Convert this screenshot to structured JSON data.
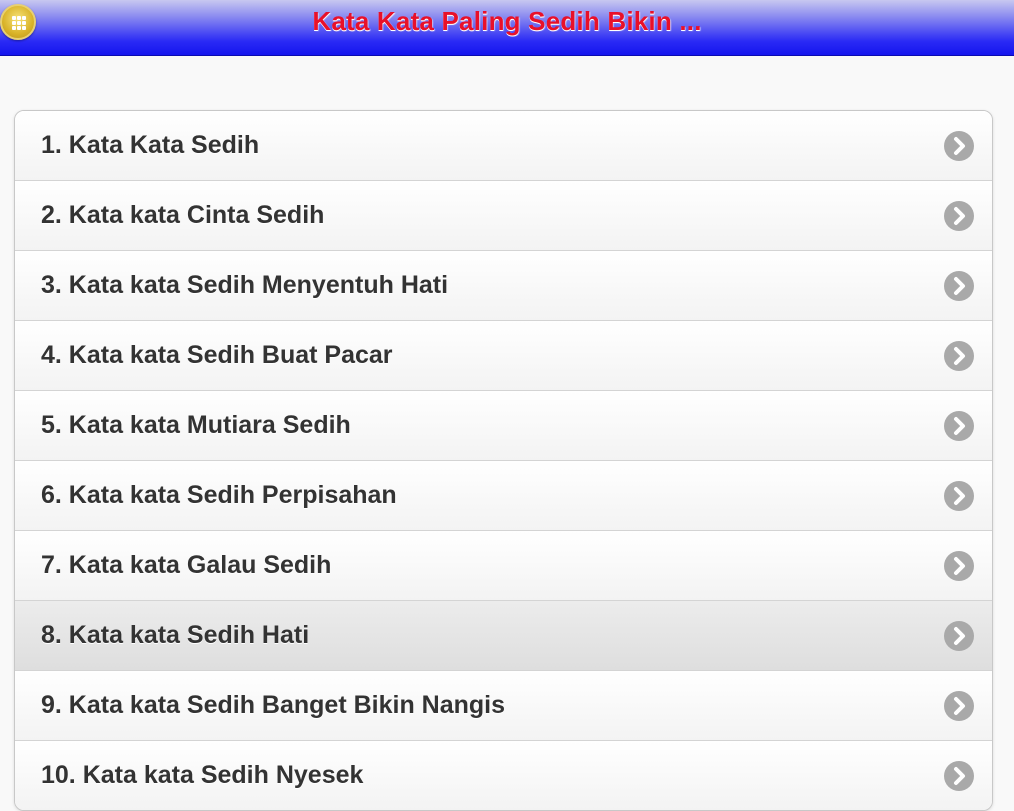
{
  "header": {
    "title": "Kata Kata Paling Sedih Bikin ...",
    "menu_icon": "grid-menu-icon"
  },
  "list": {
    "items": [
      {
        "label": "1. Kata Kata Sedih"
      },
      {
        "label": "2. Kata kata Cinta Sedih"
      },
      {
        "label": "3. Kata kata Sedih Menyentuh Hati"
      },
      {
        "label": "4. Kata kata Sedih Buat Pacar"
      },
      {
        "label": "5. Kata kata Mutiara Sedih"
      },
      {
        "label": "6. Kata kata Sedih Perpisahan"
      },
      {
        "label": "7. Kata kata Galau Sedih"
      },
      {
        "label": "8. Kata kata Sedih Hati"
      },
      {
        "label": "9. Kata kata Sedih Banget Bikin Nangis"
      },
      {
        "label": "10. Kata kata Sedih Nyesek"
      }
    ],
    "active_index": 7,
    "arrow_icon": "chevron-right-circle-icon"
  },
  "colors": {
    "title_red": "#e8102a",
    "header_blue": "#1515ee",
    "arrow_gray": "#a9a9a9"
  }
}
